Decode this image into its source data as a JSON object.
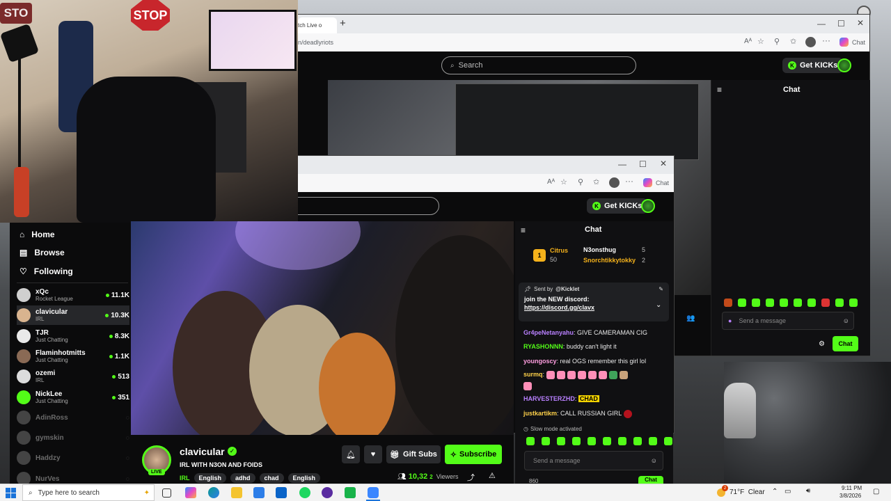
{
  "webcam": {
    "stop_sign": "STOP",
    "stop_partial": "STO"
  },
  "bg_window": {
    "tab_title": "tch Live o",
    "new_tab": "+",
    "url": "n/deadlyriots",
    "browser_chat": "Chat",
    "search_placeholder": "Search",
    "get_kicks": "Get KICKs",
    "chat_title": "Chat",
    "message_placeholder": "Send a message",
    "chat_button": "Chat"
  },
  "fg_window": {
    "browser_chat": "Chat",
    "get_kicks": "Get KICKs"
  },
  "sidebar": {
    "nav": [
      {
        "label": "Home"
      },
      {
        "label": "Browse"
      },
      {
        "label": "Following"
      }
    ],
    "channels": [
      {
        "name": "xQc",
        "category": "Rocket League",
        "viewers": "11.1K",
        "color": "#cfcfcf"
      },
      {
        "name": "clavicular",
        "category": "IRL",
        "viewers": "10.3K",
        "color": "#d9b48f"
      },
      {
        "name": "TJR",
        "category": "Just Chatting",
        "viewers": "8.3K",
        "color": "#e9e9e9"
      },
      {
        "name": "Flaminhotmitts",
        "category": "Just Chatting",
        "viewers": "1.1K",
        "color": "#8a6a55"
      },
      {
        "name": "ozemi",
        "category": "IRL",
        "viewers": "513",
        "color": "#dcdcdc"
      },
      {
        "name": "NickLee",
        "category": "Just Chatting",
        "viewers": "351",
        "color": "#53fc18"
      },
      {
        "name": "AdinRoss",
        "category": "",
        "viewers": "",
        "color": "#444"
      },
      {
        "name": "gymskin",
        "category": "",
        "viewers": "",
        "color": "#444"
      },
      {
        "name": "Haddzy",
        "category": "",
        "viewers": "",
        "color": "#444"
      },
      {
        "name": "NurVes",
        "category": "",
        "viewers": "",
        "color": "#444"
      }
    ]
  },
  "stream": {
    "live_badge": "LIVE",
    "streamer": "clavicular",
    "title": "IRL WITH N3ON AND FOIDS",
    "tags": [
      "IRL",
      "English",
      "adhd",
      "chad",
      "English"
    ],
    "gift_subs": "Gift Subs",
    "subscribe": "Subscribe",
    "viewers": "10,32",
    "viewers_sup": "2",
    "viewers_label": "Viewers"
  },
  "chat": {
    "title": "Chat",
    "leaderboard": {
      "rank": "1",
      "first_name": "Citrus",
      "first_points": "50",
      "entries": [
        {
          "name": "N3onsthug",
          "count": "5"
        },
        {
          "name": "Snorchtikkytokky",
          "count": "2"
        }
      ]
    },
    "pinned": {
      "sent_by": "Sent by",
      "author": "@Kicklet",
      "text": "join the NEW discord:",
      "link": "https://discord.gg/clavx"
    },
    "messages": [
      {
        "user": "Gr4peNetanyahu",
        "text": "GIVE CAMERAMAN CIG",
        "color": "#b980ff"
      },
      {
        "user": "RYASHONNN",
        "text": "buddy can't light it",
        "color": "#53fc18"
      },
      {
        "user": "youngoscy",
        "text": "real OGS remember this girl lol",
        "color": "#ff9ee0"
      },
      {
        "user": "surmq",
        "text": "",
        "color": "#ffd24a"
      },
      {
        "user": "HARVESTERZHD",
        "text": "CHAD",
        "color": "#b980ff"
      },
      {
        "user": "justkartikm",
        "text": "CALL RUSSIAN GIRL",
        "color": "#ffd24a"
      }
    ],
    "slow_mode": "Slow mode activated",
    "message_placeholder": "Send a message",
    "footer_count": "860",
    "chat_button": "Chat"
  },
  "taskbar": {
    "search_placeholder": "Type here to search",
    "weather": "71°F  Clear",
    "weather_badge": "2",
    "time": "9:11 PM",
    "date": "3/8/2026"
  }
}
